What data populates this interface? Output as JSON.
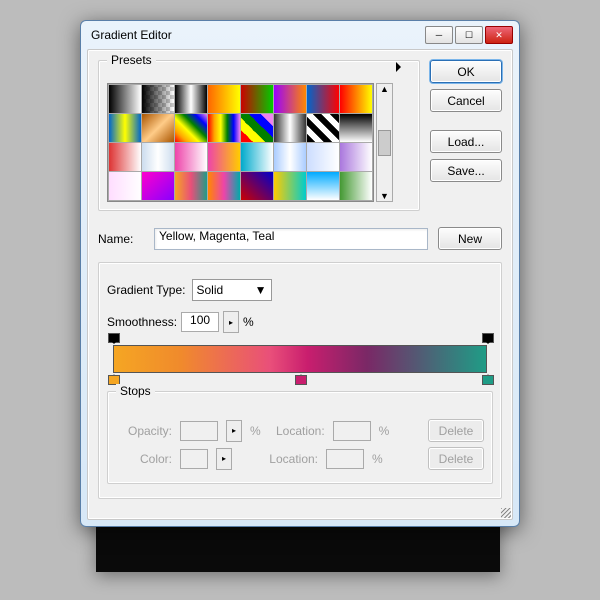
{
  "window": {
    "title": "Gradient Editor"
  },
  "buttons": {
    "ok": "OK",
    "cancel": "Cancel",
    "load": "Load...",
    "save": "Save...",
    "new": "New",
    "delete": "Delete"
  },
  "presets": {
    "label": "Presets",
    "swatches": [
      "linear-gradient(90deg,#000,#fff)",
      "linear-gradient(90deg,#000,transparent),repeating-conic-gradient(#ccc 0 25%,#fff 0 50%) 0/8px 8px",
      "linear-gradient(90deg,#000,#fff,#000)",
      "linear-gradient(90deg,#f60,#ff0)",
      "linear-gradient(90deg,#c00,#0c0)",
      "linear-gradient(90deg,#90f,#f80)",
      "linear-gradient(90deg,#06c,#f00)",
      "linear-gradient(90deg,#f00,#ff0)",
      "linear-gradient(90deg,#06c,#ff0,#06c)",
      "linear-gradient(135deg,#a50,#fc8,#a50)",
      "linear-gradient(45deg,red,orange,yellow,green,blue,violet)",
      "linear-gradient(90deg,red,orange,yellow,green,blue,violet)",
      "linear-gradient(45deg,red 0 20%,yellow 0 40%,green 0 60%,blue 0 80%,violet 0)",
      "linear-gradient(90deg,#333,#fff,#333)",
      "repeating-linear-gradient(45deg,#000 0 6px,#fff 6px 12px)",
      "linear-gradient(180deg,#000,#fff)",
      "linear-gradient(90deg,#d33,#fff)",
      "linear-gradient(90deg,#cde,#fff,#cde)",
      "linear-gradient(90deg,#e4a,#fff)",
      "linear-gradient(90deg,#e4a,#fc0)",
      "linear-gradient(90deg,#0ac,#fff)",
      "linear-gradient(90deg,#acf,#fff,#acf)",
      "linear-gradient(90deg,#cdf,#fff)",
      "linear-gradient(90deg,#a7d,#fff)",
      "linear-gradient(90deg,#fdf,#fff)",
      "linear-gradient(135deg,#f0c,#80f)",
      "linear-gradient(90deg,#f5a623,#e94f7a,#1f9c86)",
      "linear-gradient(90deg,#f80,#e4a,#0aa)",
      "linear-gradient(45deg,#c00,#00c)",
      "linear-gradient(90deg,#fc0,#0cc)",
      "linear-gradient(180deg,#0af,#fff)",
      "linear-gradient(90deg,#493,#fff)"
    ]
  },
  "name": {
    "label": "Name:",
    "value": "Yellow, Magenta, Teal"
  },
  "gradient": {
    "type_label": "Gradient Type:",
    "type_value": "Solid",
    "smooth_label": "Smoothness:",
    "smooth_value": "100",
    "pct": "%",
    "stops": [
      {
        "pos": 0,
        "color": "#f5a623"
      },
      {
        "pos": 50,
        "color": "#c91e6e"
      },
      {
        "pos": 100,
        "color": "#1f9c86"
      }
    ],
    "opacity_stops": [
      {
        "pos": 0
      },
      {
        "pos": 100
      }
    ]
  },
  "stops": {
    "label": "Stops",
    "opacity": "Opacity:",
    "color": "Color:",
    "location": "Location:"
  }
}
